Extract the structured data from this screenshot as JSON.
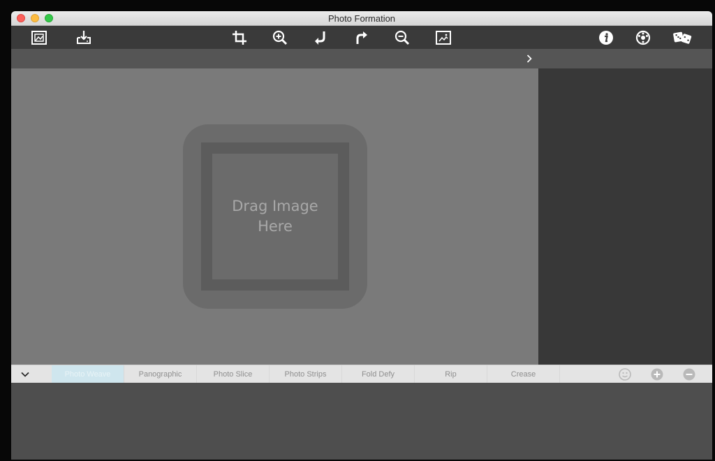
{
  "window": {
    "title": "Photo Formation"
  },
  "toolbar": {
    "buttons": [
      {
        "name": "open-image-icon"
      },
      {
        "name": "save-download-icon"
      },
      {
        "name": "crop-icon"
      },
      {
        "name": "zoom-in-icon"
      },
      {
        "name": "rotate-left-icon"
      },
      {
        "name": "rotate-right-icon"
      },
      {
        "name": "zoom-out-icon"
      },
      {
        "name": "fit-image-icon"
      },
      {
        "name": "info-icon"
      },
      {
        "name": "settings-gear-icon"
      },
      {
        "name": "randomize-dice-icon"
      }
    ]
  },
  "canvas": {
    "drop_text": "Drag Image\nHere"
  },
  "tabs": [
    {
      "label": "Photo Weave",
      "active": true
    },
    {
      "label": "Panographic",
      "active": false
    },
    {
      "label": "Photo Slice",
      "active": false
    },
    {
      "label": "Photo Strips",
      "active": false
    },
    {
      "label": "Fold Defy",
      "active": false
    },
    {
      "label": "Rip",
      "active": false
    },
    {
      "label": "Crease",
      "active": false
    }
  ],
  "tab_actions": [
    {
      "name": "preset-smiley-icon"
    },
    {
      "name": "add-preset-icon"
    },
    {
      "name": "remove-preset-icon"
    }
  ],
  "colors": {
    "toolbar_bg": "#3a3a3a",
    "canvas_bg": "#7a7a7a",
    "side_panel_bg": "#383838",
    "active_tab_bg": "#cfe6ee"
  }
}
